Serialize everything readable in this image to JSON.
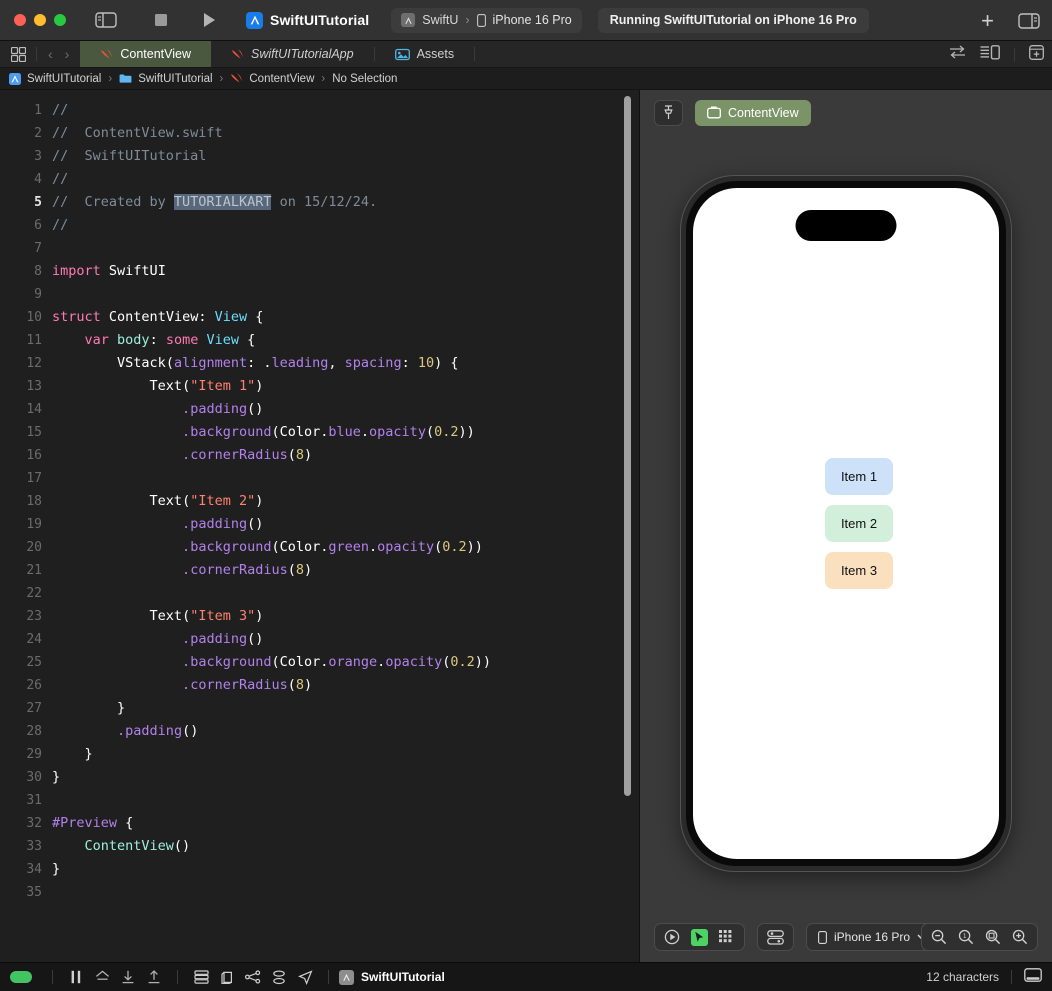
{
  "window": {
    "project_name": "SwiftUITutorial",
    "scheme_name": "SwiftU",
    "scheme_sep": "›",
    "device_name": "iPhone 16 Pro",
    "status_text": "Running SwiftUITutorial on iPhone 16 Pro"
  },
  "tabs": [
    {
      "label": "ContentView",
      "icon": "swift-icon",
      "active": true,
      "italic": false
    },
    {
      "label": "SwiftUITutorialApp",
      "icon": "swift-icon",
      "active": false,
      "italic": true
    },
    {
      "label": "Assets",
      "icon": "assets-icon",
      "active": false,
      "italic": false
    }
  ],
  "breadcrumb": [
    {
      "label": "SwiftUITutorial",
      "icon": "app-target-icon"
    },
    {
      "label": "SwiftUITutorial",
      "icon": "folder-icon"
    },
    {
      "label": "ContentView",
      "icon": "swift-icon"
    },
    {
      "label": "No Selection",
      "icon": "none"
    }
  ],
  "breadcrumb_separator": "›",
  "editor": {
    "current_line": 5,
    "lines": [
      {
        "n": 1,
        "tokens": [
          {
            "t": "//",
            "c": "c-com"
          }
        ]
      },
      {
        "n": 2,
        "tokens": [
          {
            "t": "//  ContentView.swift",
            "c": "c-com"
          }
        ]
      },
      {
        "n": 3,
        "tokens": [
          {
            "t": "//  SwiftUITutorial",
            "c": "c-com"
          }
        ]
      },
      {
        "n": 4,
        "tokens": [
          {
            "t": "//",
            "c": "c-com"
          }
        ]
      },
      {
        "n": 5,
        "tokens": [
          {
            "t": "//  Created by ",
            "c": "c-com"
          },
          {
            "t": "TUTORIALKART",
            "c": "c-sel"
          },
          {
            "t": " on 15/12/24.",
            "c": "c-com"
          }
        ]
      },
      {
        "n": 6,
        "tokens": [
          {
            "t": "//",
            "c": "c-com"
          }
        ]
      },
      {
        "n": 7,
        "tokens": []
      },
      {
        "n": 8,
        "tokens": [
          {
            "t": "import",
            "c": "c-kw"
          },
          {
            "t": " ",
            "c": "c-plain"
          },
          {
            "t": "SwiftUI",
            "c": "c-plain"
          }
        ]
      },
      {
        "n": 9,
        "tokens": []
      },
      {
        "n": 10,
        "tokens": [
          {
            "t": "struct",
            "c": "c-kw"
          },
          {
            "t": " ",
            "c": "c-plain"
          },
          {
            "t": "ContentView",
            "c": "c-plain"
          },
          {
            "t": ": ",
            "c": "c-plain"
          },
          {
            "t": "View",
            "c": "c-type"
          },
          {
            "t": " {",
            "c": "c-plain"
          }
        ]
      },
      {
        "n": 11,
        "tokens": [
          {
            "t": "    ",
            "c": "c-plain"
          },
          {
            "t": "var",
            "c": "c-kw"
          },
          {
            "t": " ",
            "c": "c-plain"
          },
          {
            "t": "body",
            "c": "c-tealn"
          },
          {
            "t": ": ",
            "c": "c-plain"
          },
          {
            "t": "some",
            "c": "c-kw"
          },
          {
            "t": " ",
            "c": "c-plain"
          },
          {
            "t": "View",
            "c": "c-type"
          },
          {
            "t": " {",
            "c": "c-plain"
          }
        ]
      },
      {
        "n": 12,
        "tokens": [
          {
            "t": "        ",
            "c": "c-plain"
          },
          {
            "t": "VStack",
            "c": "c-plain"
          },
          {
            "t": "(",
            "c": "c-plain"
          },
          {
            "t": "alignment",
            "c": "c-param"
          },
          {
            "t": ": .",
            "c": "c-plain"
          },
          {
            "t": "leading",
            "c": "c-param"
          },
          {
            "t": ", ",
            "c": "c-plain"
          },
          {
            "t": "spacing",
            "c": "c-param"
          },
          {
            "t": ": ",
            "c": "c-plain"
          },
          {
            "t": "10",
            "c": "c-num"
          },
          {
            "t": ") {",
            "c": "c-plain"
          }
        ]
      },
      {
        "n": 13,
        "tokens": [
          {
            "t": "            ",
            "c": "c-plain"
          },
          {
            "t": "Text",
            "c": "c-plain"
          },
          {
            "t": "(",
            "c": "c-plain"
          },
          {
            "t": "\"Item 1\"",
            "c": "c-str"
          },
          {
            "t": ")",
            "c": "c-plain"
          }
        ]
      },
      {
        "n": 14,
        "tokens": [
          {
            "t": "                ",
            "c": "c-plain"
          },
          {
            "t": ".",
            "c": "c-meth"
          },
          {
            "t": "padding",
            "c": "c-meth"
          },
          {
            "t": "()",
            "c": "c-plain"
          }
        ]
      },
      {
        "n": 15,
        "tokens": [
          {
            "t": "                ",
            "c": "c-plain"
          },
          {
            "t": ".",
            "c": "c-meth"
          },
          {
            "t": "background",
            "c": "c-meth"
          },
          {
            "t": "(",
            "c": "c-plain"
          },
          {
            "t": "Color",
            "c": "c-plain"
          },
          {
            "t": ".",
            "c": "c-plain"
          },
          {
            "t": "blue",
            "c": "c-meth"
          },
          {
            "t": ".",
            "c": "c-plain"
          },
          {
            "t": "opacity",
            "c": "c-meth"
          },
          {
            "t": "(",
            "c": "c-plain"
          },
          {
            "t": "0.2",
            "c": "c-num"
          },
          {
            "t": "))",
            "c": "c-plain"
          }
        ]
      },
      {
        "n": 16,
        "tokens": [
          {
            "t": "                ",
            "c": "c-plain"
          },
          {
            "t": ".",
            "c": "c-meth"
          },
          {
            "t": "cornerRadius",
            "c": "c-meth"
          },
          {
            "t": "(",
            "c": "c-plain"
          },
          {
            "t": "8",
            "c": "c-num"
          },
          {
            "t": ")",
            "c": "c-plain"
          }
        ]
      },
      {
        "n": 17,
        "tokens": []
      },
      {
        "n": 18,
        "tokens": [
          {
            "t": "            ",
            "c": "c-plain"
          },
          {
            "t": "Text",
            "c": "c-plain"
          },
          {
            "t": "(",
            "c": "c-plain"
          },
          {
            "t": "\"Item 2\"",
            "c": "c-str"
          },
          {
            "t": ")",
            "c": "c-plain"
          }
        ]
      },
      {
        "n": 19,
        "tokens": [
          {
            "t": "                ",
            "c": "c-plain"
          },
          {
            "t": ".",
            "c": "c-meth"
          },
          {
            "t": "padding",
            "c": "c-meth"
          },
          {
            "t": "()",
            "c": "c-plain"
          }
        ]
      },
      {
        "n": 20,
        "tokens": [
          {
            "t": "                ",
            "c": "c-plain"
          },
          {
            "t": ".",
            "c": "c-meth"
          },
          {
            "t": "background",
            "c": "c-meth"
          },
          {
            "t": "(",
            "c": "c-plain"
          },
          {
            "t": "Color",
            "c": "c-plain"
          },
          {
            "t": ".",
            "c": "c-plain"
          },
          {
            "t": "green",
            "c": "c-meth"
          },
          {
            "t": ".",
            "c": "c-plain"
          },
          {
            "t": "opacity",
            "c": "c-meth"
          },
          {
            "t": "(",
            "c": "c-plain"
          },
          {
            "t": "0.2",
            "c": "c-num"
          },
          {
            "t": "))",
            "c": "c-plain"
          }
        ]
      },
      {
        "n": 21,
        "tokens": [
          {
            "t": "                ",
            "c": "c-plain"
          },
          {
            "t": ".",
            "c": "c-meth"
          },
          {
            "t": "cornerRadius",
            "c": "c-meth"
          },
          {
            "t": "(",
            "c": "c-plain"
          },
          {
            "t": "8",
            "c": "c-num"
          },
          {
            "t": ")",
            "c": "c-plain"
          }
        ]
      },
      {
        "n": 22,
        "tokens": []
      },
      {
        "n": 23,
        "tokens": [
          {
            "t": "            ",
            "c": "c-plain"
          },
          {
            "t": "Text",
            "c": "c-plain"
          },
          {
            "t": "(",
            "c": "c-plain"
          },
          {
            "t": "\"Item 3\"",
            "c": "c-str"
          },
          {
            "t": ")",
            "c": "c-plain"
          }
        ]
      },
      {
        "n": 24,
        "tokens": [
          {
            "t": "                ",
            "c": "c-plain"
          },
          {
            "t": ".",
            "c": "c-meth"
          },
          {
            "t": "padding",
            "c": "c-meth"
          },
          {
            "t": "()",
            "c": "c-plain"
          }
        ]
      },
      {
        "n": 25,
        "tokens": [
          {
            "t": "                ",
            "c": "c-plain"
          },
          {
            "t": ".",
            "c": "c-meth"
          },
          {
            "t": "background",
            "c": "c-meth"
          },
          {
            "t": "(",
            "c": "c-plain"
          },
          {
            "t": "Color",
            "c": "c-plain"
          },
          {
            "t": ".",
            "c": "c-plain"
          },
          {
            "t": "orange",
            "c": "c-meth"
          },
          {
            "t": ".",
            "c": "c-plain"
          },
          {
            "t": "opacity",
            "c": "c-meth"
          },
          {
            "t": "(",
            "c": "c-plain"
          },
          {
            "t": "0.2",
            "c": "c-num"
          },
          {
            "t": "))",
            "c": "c-plain"
          }
        ]
      },
      {
        "n": 26,
        "tokens": [
          {
            "t": "                ",
            "c": "c-plain"
          },
          {
            "t": ".",
            "c": "c-meth"
          },
          {
            "t": "cornerRadius",
            "c": "c-meth"
          },
          {
            "t": "(",
            "c": "c-plain"
          },
          {
            "t": "8",
            "c": "c-num"
          },
          {
            "t": ")",
            "c": "c-plain"
          }
        ]
      },
      {
        "n": 27,
        "tokens": [
          {
            "t": "        }",
            "c": "c-plain"
          }
        ]
      },
      {
        "n": 28,
        "tokens": [
          {
            "t": "        ",
            "c": "c-plain"
          },
          {
            "t": ".",
            "c": "c-meth"
          },
          {
            "t": "padding",
            "c": "c-meth"
          },
          {
            "t": "()",
            "c": "c-plain"
          }
        ]
      },
      {
        "n": 29,
        "tokens": [
          {
            "t": "    }",
            "c": "c-plain"
          }
        ]
      },
      {
        "n": 30,
        "tokens": [
          {
            "t": "}",
            "c": "c-plain"
          }
        ]
      },
      {
        "n": 31,
        "tokens": []
      },
      {
        "n": 32,
        "tokens": [
          {
            "t": "#Preview",
            "c": "c-meth"
          },
          {
            "t": " {",
            "c": "c-plain"
          }
        ]
      },
      {
        "n": 33,
        "tokens": [
          {
            "t": "    ",
            "c": "c-plain"
          },
          {
            "t": "ContentView",
            "c": "c-tealn"
          },
          {
            "t": "()",
            "c": "c-plain"
          }
        ]
      },
      {
        "n": 34,
        "tokens": [
          {
            "t": "}",
            "c": "c-plain"
          }
        ]
      },
      {
        "n": 35,
        "tokens": []
      }
    ]
  },
  "canvas": {
    "preview_label": "ContentView",
    "device_selector": "iPhone 16 Pro",
    "preview_items": [
      {
        "label": "Item 1",
        "bg": "#cde1f8"
      },
      {
        "label": "Item 2",
        "bg": "#d2efdb"
      },
      {
        "label": "Item 3",
        "bg": "#fbe0c0"
      }
    ]
  },
  "statusbar": {
    "project_name": "SwiftUITutorial",
    "characters_text": "12 characters"
  },
  "colors": {
    "accent_green": "#4cd363",
    "tab_active_bg": "#4a5840",
    "preview_chip_bg": "#7b9467",
    "swift_orange": "#f05138",
    "xcode_blue": "#1a7ce8"
  }
}
